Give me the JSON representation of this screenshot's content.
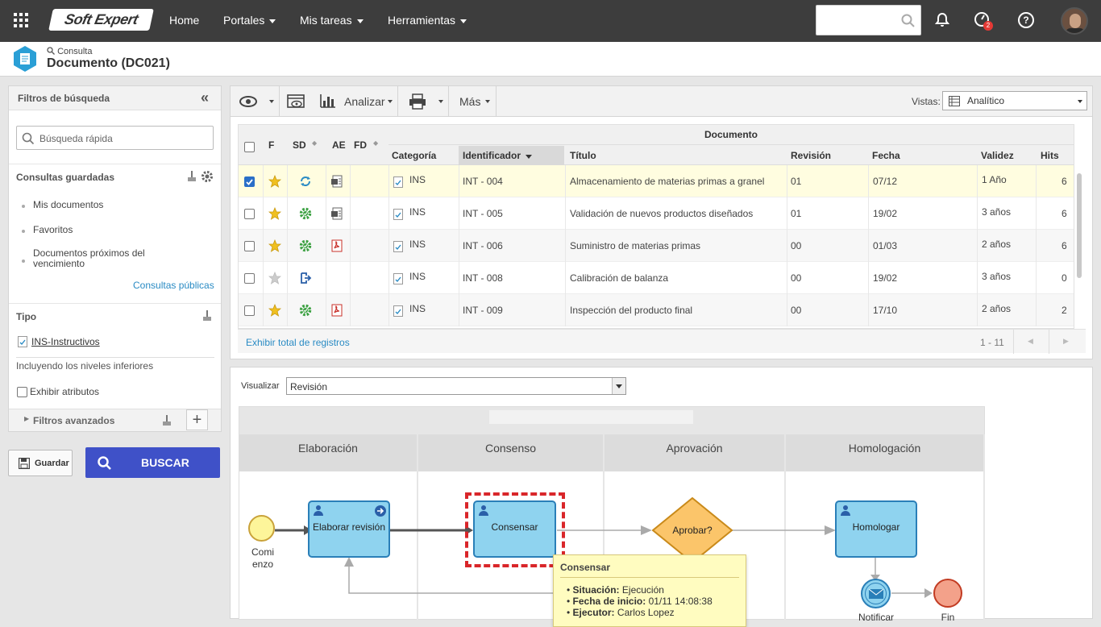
{
  "topbar": {
    "brand": "Soft Expert",
    "nav": [
      "Home",
      "Portales",
      "Mis tareas",
      "Herramientas"
    ],
    "notif_badge": "2"
  },
  "header": {
    "breadcrumb": "Consulta",
    "title": "Documento (DC021)"
  },
  "filters": {
    "title": "Filtros de búsqueda",
    "quick_search_placeholder": "Búsqueda rápida",
    "saved_title": "Consultas guardadas",
    "saved_items": [
      "Mis documentos",
      "Favoritos",
      "Documentos próximos del vencimiento"
    ],
    "public_link": "Consultas públicas",
    "tipo_title": "Tipo",
    "tipo_item": "INS-Instructivos",
    "tipo_note": "Incluyendo los niveles inferiores",
    "show_attrs": "Exhibir atributos",
    "advanced": "Filtros avanzados",
    "save_label": "Guardar",
    "search_label": "BUSCAR"
  },
  "toolbar": {
    "analyze": "Analizar",
    "more": "Más",
    "views_label": "Vistas:",
    "views_value": "Analítico"
  },
  "grid": {
    "group_header": "Documento",
    "headers": {
      "f": "F",
      "sd": "SD",
      "ae": "AE",
      "fd": "FD",
      "categoria": "Categoría",
      "identificador": "Identificador",
      "titulo": "Título",
      "revision": "Revisión",
      "fecha": "Fecha",
      "validez": "Validez",
      "hits": "Hits"
    },
    "rows": [
      {
        "checked": true,
        "star": true,
        "sd": "cycle",
        "ae": "doc",
        "cat": "INS",
        "id": "INT - 004",
        "title": "Almacenamiento de materias primas a granel",
        "rev": "01",
        "date": "07/12",
        "valid": "1 Año",
        "hits": "6"
      },
      {
        "checked": false,
        "star": true,
        "sd": "gear",
        "ae": "doc",
        "cat": "INS",
        "id": "INT - 005",
        "title": "Validación de nuevos productos diseñados",
        "rev": "01",
        "date": "19/02",
        "valid": "3 años",
        "hits": "6"
      },
      {
        "checked": false,
        "star": true,
        "sd": "gear",
        "ae": "pdf",
        "cat": "INS",
        "id": "INT - 006",
        "title": "Suministro de materias primas",
        "rev": "00",
        "date": "01/03",
        "valid": "2 años",
        "hits": "6"
      },
      {
        "checked": false,
        "star": false,
        "sd": "arrow",
        "ae": "",
        "cat": "INS",
        "id": "INT - 008",
        "title": "Calibración de balanza",
        "rev": "00",
        "date": "19/02",
        "valid": "3 años",
        "hits": "0"
      },
      {
        "checked": false,
        "star": true,
        "sd": "gear",
        "ae": "pdf",
        "cat": "INS",
        "id": "INT - 009",
        "title": "Inspección del producto final",
        "rev": "00",
        "date": "17/10",
        "valid": "2 años",
        "hits": "2"
      }
    ],
    "total_link": "Exhibir total de registros",
    "pager": "1 - 11"
  },
  "bottom": {
    "visualize_label": "Visualizar",
    "visualize_value": "Revisión",
    "lanes": [
      "Elaboración",
      "Consenso",
      "Aprovación",
      "Homologación"
    ],
    "start_label_1": "Comi",
    "start_label_2": "enzo",
    "task_elaborar": "Elaborar revisión",
    "task_consensar": "Consensar",
    "gateway": "Aprobar?",
    "task_homologar": "Homologar",
    "notify": "Notificar",
    "end": "Fin",
    "tooltip": {
      "title": "Consensar",
      "situacion_label": "Situación:",
      "situacion": "Ejecución",
      "fecha_label": "Fecha de inicio:",
      "fecha": "01/11 14:08:38",
      "ejecutor_label": "Ejecutor:",
      "ejecutor": "Carlos Lopez"
    }
  },
  "colors": {
    "topbar": "#3d3d3d",
    "primary": "#3f51c8",
    "highlight_row": "#fffde0",
    "task_fill": "#8fd3ef",
    "gateway_fill": "#fbc56a",
    "accent": "#2a8bc4"
  }
}
